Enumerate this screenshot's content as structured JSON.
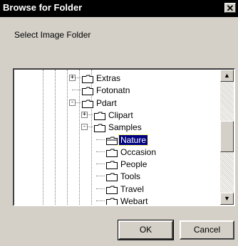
{
  "window": {
    "title": "Browse for Folder",
    "close_glyph": "✕"
  },
  "prompt": "Select Image Folder",
  "tree": {
    "items": [
      {
        "label": "Extras",
        "expander": "+",
        "selected": false
      },
      {
        "label": "Fotonatn",
        "expander": "",
        "selected": false
      },
      {
        "label": "Pdart",
        "expander": "-",
        "selected": false
      },
      {
        "label": "Clipart",
        "expander": "+",
        "selected": false
      },
      {
        "label": "Samples",
        "expander": "-",
        "selected": false
      },
      {
        "label": "Nature",
        "expander": "",
        "selected": true
      },
      {
        "label": "Occasion",
        "expander": "",
        "selected": false
      },
      {
        "label": "People",
        "expander": "",
        "selected": false
      },
      {
        "label": "Tools",
        "expander": "",
        "selected": false
      },
      {
        "label": "Travel",
        "expander": "",
        "selected": false
      },
      {
        "label": "Webart",
        "expander": "",
        "selected": false
      }
    ]
  },
  "scrollbar": {
    "up_icon": "up-arrow-icon",
    "down_icon": "down-arrow-icon"
  },
  "buttons": {
    "ok": "OK",
    "cancel": "Cancel"
  },
  "colors": {
    "titlebar": "#000000",
    "face": "#d4d0c8",
    "selection": "#000080"
  }
}
